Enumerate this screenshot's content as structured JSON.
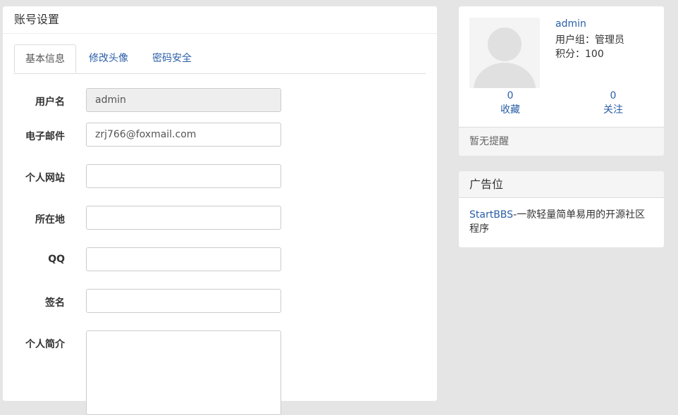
{
  "main": {
    "heading": "账号设置",
    "tabs": [
      {
        "label": "基本信息",
        "active": true
      },
      {
        "label": "修改头像",
        "active": false
      },
      {
        "label": "密码安全",
        "active": false
      }
    ],
    "form": {
      "username": {
        "label": "用户名",
        "value": "admin"
      },
      "email": {
        "label": "电子邮件",
        "value": "zrj766@foxmail.com"
      },
      "website": {
        "label": "个人网站",
        "value": ""
      },
      "location": {
        "label": "所在地",
        "value": ""
      },
      "qq": {
        "label": "QQ",
        "value": ""
      },
      "signature": {
        "label": "签名",
        "value": ""
      },
      "intro": {
        "label": "个人简介",
        "value": ""
      }
    }
  },
  "user_panel": {
    "username": "admin",
    "usergroup": "用户组：管理员",
    "points": "积分：100",
    "favorites_count": "0",
    "favorites_label": "收藏",
    "follow_count": "0",
    "follow_label": "关注",
    "notice": "暂无提醒"
  },
  "ad": {
    "heading": "广告位",
    "link_text": "StartBBS",
    "text": "-一款轻量简单易用的开源社区程序"
  },
  "colors": {
    "link": "#2a5ea8",
    "background": "#e5e5e5",
    "panel": "#ffffff"
  }
}
